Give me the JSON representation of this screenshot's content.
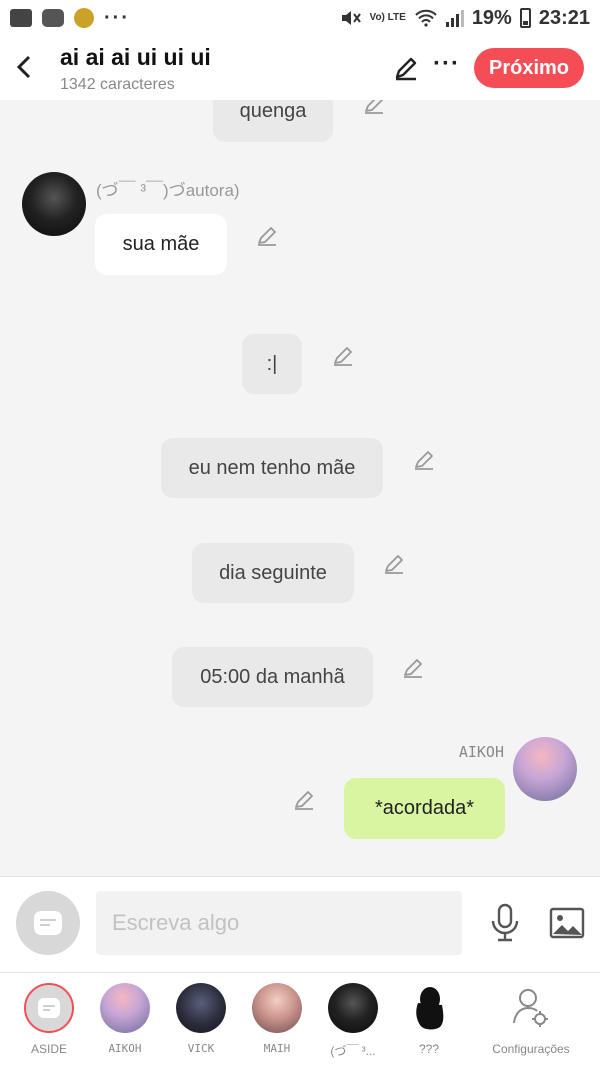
{
  "status_bar": {
    "battery": "19%",
    "time": "23:21",
    "network_label": "Vo) LTE"
  },
  "header": {
    "title": "ai ai ai ui ui ui",
    "subtitle": "1342 caracteres",
    "next_label": "Próximo"
  },
  "messages": [
    {
      "type": "narration",
      "text": "quenga"
    },
    {
      "type": "character",
      "sender": "(づ￣ ³￣)づautora)",
      "text": "sua mãe"
    },
    {
      "type": "narration",
      "text": ":|"
    },
    {
      "type": "narration",
      "text": "eu nem tenho mãe"
    },
    {
      "type": "narration",
      "text": "dia seguinte"
    },
    {
      "type": "narration",
      "text": "05:00 da manhã"
    },
    {
      "type": "character-right",
      "sender": "AIKOH",
      "text": "*acordada*"
    }
  ],
  "input": {
    "placeholder": "Escreva algo"
  },
  "tabs": [
    {
      "label": "ASIDE"
    },
    {
      "label": "AIKOH"
    },
    {
      "label": "VICK"
    },
    {
      "label": "MAIH"
    },
    {
      "label": "(づ￣ ³..."
    },
    {
      "label": "???"
    },
    {
      "label": "Configurações"
    }
  ],
  "colors": {
    "accent": "#f54d55",
    "right_bubble": "#d9f5a2",
    "narration_bubble": "#e9e9e9",
    "chat_background": "#f4f4f4"
  },
  "icons": {
    "edit": "pencil-icon",
    "more": "more-icon",
    "back": "chevron-left-icon",
    "mic": "microphone-icon",
    "image": "image-icon",
    "settings": "user-settings-icon"
  }
}
